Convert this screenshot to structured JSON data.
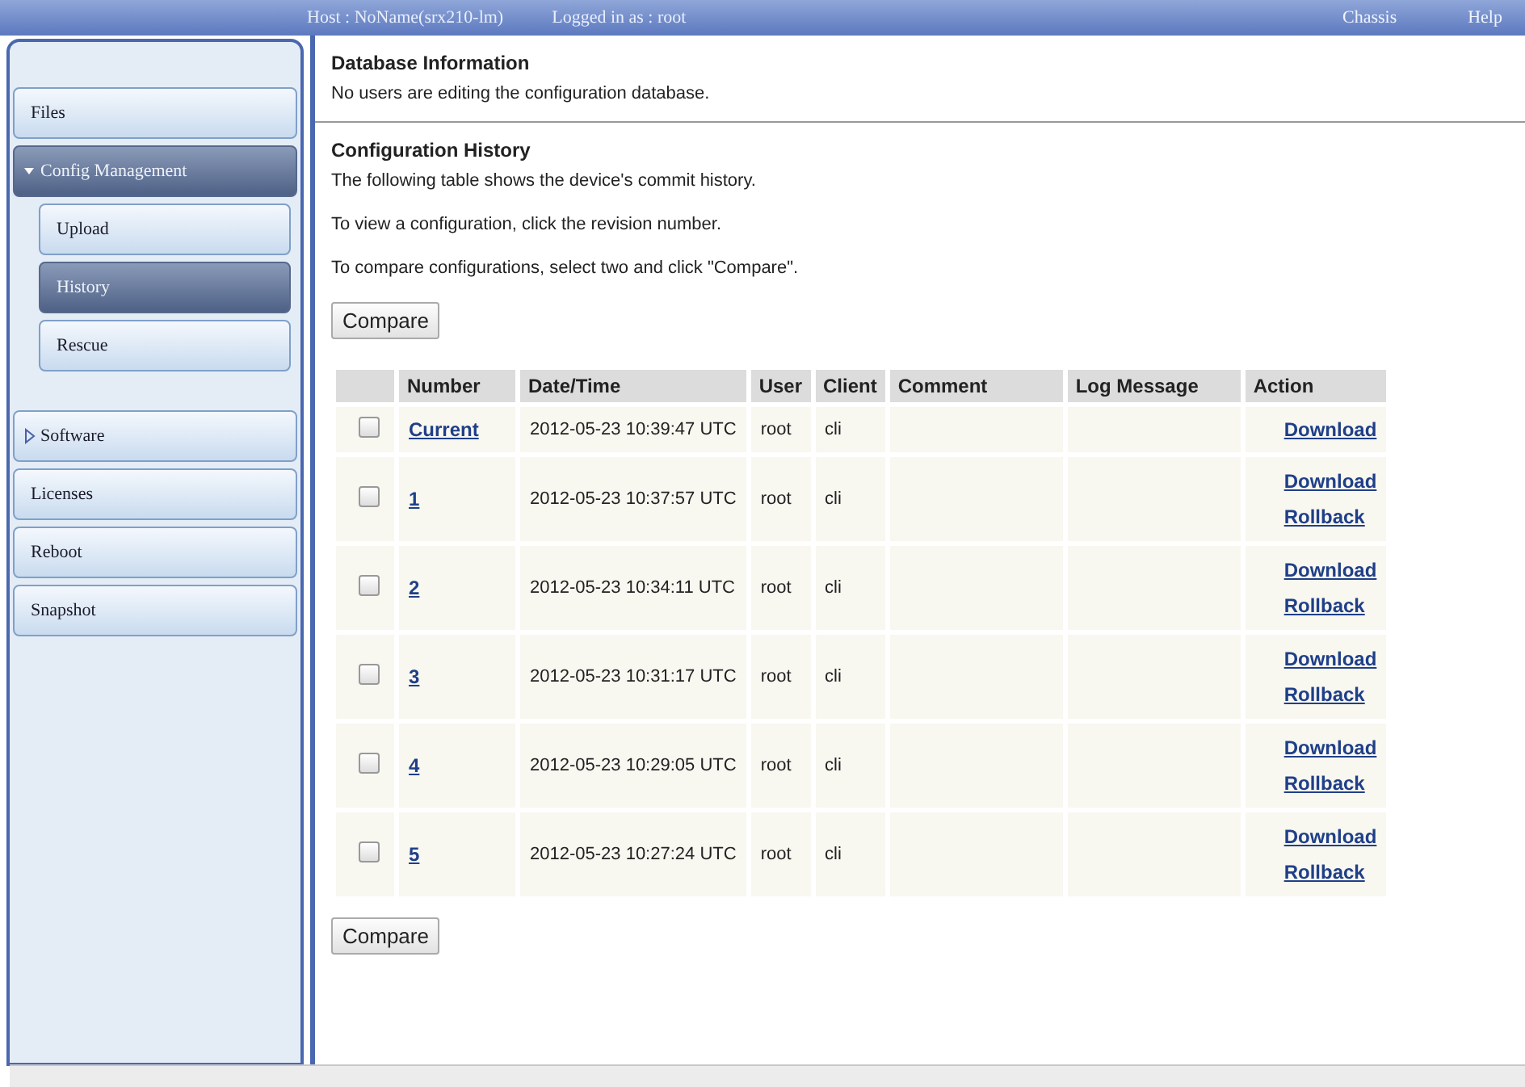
{
  "top_bar": {
    "host": "Host : NoName(srx210-lm)",
    "user": "Logged in as : root",
    "links": [
      "Chassis",
      "Help"
    ]
  },
  "sidebar": {
    "items": [
      {
        "label": "Files",
        "kind": "link",
        "selected": false
      },
      {
        "label": "Config Management",
        "kind": "group",
        "expanded": true,
        "selected": true,
        "children": [
          {
            "label": "Upload",
            "selected": false
          },
          {
            "label": "History",
            "selected": true
          },
          {
            "label": "Rescue",
            "selected": false
          }
        ]
      },
      {
        "label": "Software",
        "kind": "group",
        "expanded": false,
        "selected": false
      },
      {
        "label": "Licenses",
        "kind": "link",
        "selected": false
      },
      {
        "label": "Reboot",
        "kind": "link",
        "selected": false
      },
      {
        "label": "Snapshot",
        "kind": "link",
        "selected": false
      }
    ]
  },
  "database_info": {
    "title": "Database Information",
    "text": "No users are editing the configuration database."
  },
  "history": {
    "title": "Configuration History",
    "paragraphs": [
      "The following table shows the device's commit history.",
      "To view a configuration, click the revision number.",
      "To compare configurations, select two and click \"Compare\"."
    ],
    "compare_button": "Compare",
    "table": {
      "columns": [
        "Number",
        "Date/Time",
        "User",
        "Client",
        "Comment",
        "Log Message",
        "Action"
      ],
      "rows": [
        {
          "checked": false,
          "number": "Current",
          "datetime": "2012-05-23 10:39:47 UTC",
          "user": "root",
          "client": "cli",
          "actions": [
            "Download"
          ]
        },
        {
          "checked": false,
          "number": "1",
          "datetime": "2012-05-23 10:37:57 UTC",
          "user": "root",
          "client": "cli",
          "actions": [
            "Download",
            "Rollback"
          ]
        },
        {
          "checked": false,
          "number": "2",
          "datetime": "2012-05-23 10:34:11 UTC",
          "user": "root",
          "client": "cli",
          "actions": [
            "Download",
            "Rollback"
          ]
        },
        {
          "checked": false,
          "number": "3",
          "datetime": "2012-05-23 10:31:17 UTC",
          "user": "root",
          "client": "cli",
          "actions": [
            "Download",
            "Rollback"
          ]
        },
        {
          "checked": false,
          "number": "4",
          "datetime": "2012-05-23 10:29:05 UTC",
          "user": "root",
          "client": "cli",
          "actions": [
            "Download",
            "Rollback"
          ]
        },
        {
          "checked": false,
          "number": "5",
          "datetime": "2012-05-23 10:27:24 UTC",
          "user": "root",
          "client": "cli",
          "actions": [
            "Download",
            "Rollback"
          ]
        }
      ]
    },
    "bottom_compare_button": "Compare"
  }
}
